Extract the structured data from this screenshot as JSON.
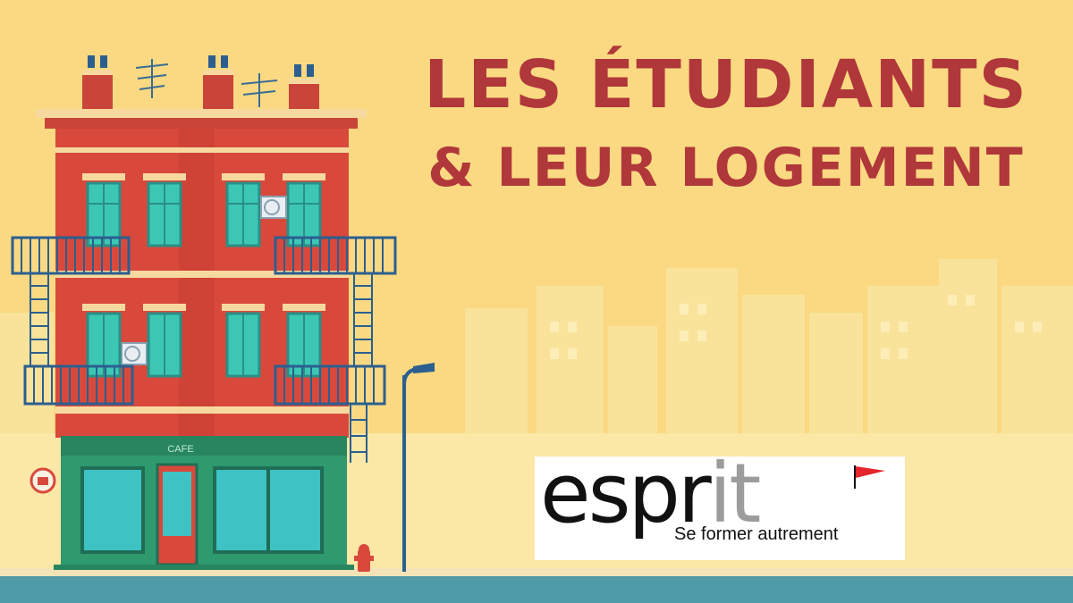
{
  "banner": {
    "title_line1": "LES ÉTUDIANTS",
    "title_line2": "& LEUR LOGEMENT"
  },
  "building": {
    "shop_sign": "CAFE"
  },
  "logo": {
    "word_dark": "espr",
    "word_light": "it",
    "tagline": "Se former autrement"
  },
  "colors": {
    "background": "#fbd982",
    "title": "#b0373a",
    "brick": "#d8493c",
    "shop": "#2f9a6e",
    "street": "#4f9ba8",
    "logo_flag": "#e4262c"
  },
  "icons": [
    "cafe-sign-icon",
    "fire-hydrant-icon",
    "street-lamp-icon",
    "antenna-icon",
    "air-conditioner-icon",
    "flag-icon"
  ]
}
